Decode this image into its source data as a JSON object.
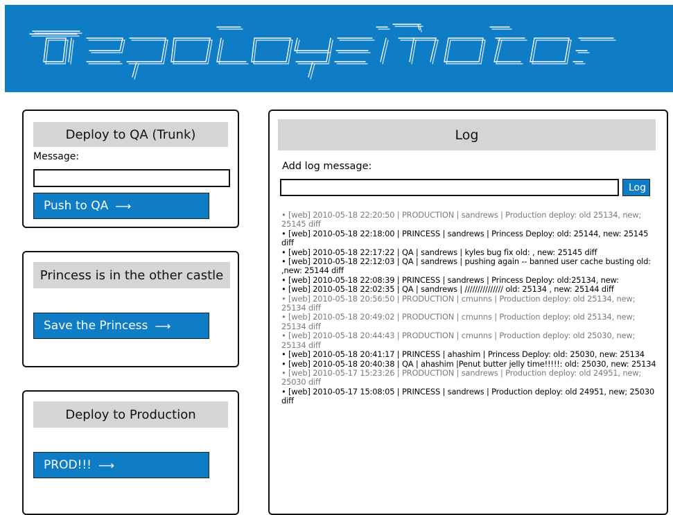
{
  "banner": {
    "logo_text": "deploymotron",
    "bg_color": "#0f7cc6"
  },
  "qa_panel": {
    "title": "Deploy to QA (Trunk)",
    "message_label": "Message:",
    "message_value": "",
    "button_label": "Push to QA",
    "button_icon": "arrow-right-icon"
  },
  "princess_panel": {
    "title": "Princess is in the other castle",
    "button_label": "Save the Princess",
    "button_icon": "arrow-right-icon"
  },
  "prod_panel": {
    "title": "Deploy to Production",
    "button_label": "PROD!!!",
    "button_icon": "arrow-right-icon"
  },
  "log_panel": {
    "title": "Log",
    "add_label": "Add log message:",
    "input_value": "",
    "button_label": "Log",
    "entries": [
      {
        "type": "prod",
        "text": "• [web] 2010-05-18 22:20:50 | PRODUCTION | sandrews | Production deploy: old 25134, new; 25145 diff"
      },
      {
        "type": "other",
        "text": "• [web] 2010-05-18 22:18:00 | PRINCESS | sandrews | Princess Deploy: old: 25144, new: 25145 diff"
      },
      {
        "type": "other",
        "text": "• [web] 2010-05-18 22:17:22 | QA | sandrews | kyles bug fix old: , new: 25145 diff"
      },
      {
        "type": "other",
        "text": "• [web] 2010-05-18 22:12:03 | QA | sandrews | pushing again -- banned user cache busting old: ,new: 25144 diff"
      },
      {
        "type": "other",
        "text": "• [web] 2010-05-18 22:08:39 | PRINCESS | sandrews | Princess Deploy: old:25134, new:"
      },
      {
        "type": "other",
        "text": "• [web] 2010-05-18 22:02:35 | QA | sandrews | /////////////// old: 25134 , new: 25144 diff"
      },
      {
        "type": "prod",
        "text": "• [web] 2010-05-18 20:56:50 | PRODUCTION | cmunns | Production deploy: old 25134, new; 25134 diff"
      },
      {
        "type": "prod",
        "text": "• [web] 2010-05-18 20:49:02 | PRODUCTION | cmunns | Production deploy: old 25134, new; 25134 diff"
      },
      {
        "type": "prod",
        "text": "• [web] 2010-05-18 20:44:43 | PRODUCTION | cmunns | Production deploy: old 25030, new; 25134 diff"
      },
      {
        "type": "other",
        "text": "• [web] 2010-05-18 20:41:17 | PRINCESS | ahashim | Princess Deploy: old: 25030, new: 25134"
      },
      {
        "type": "other",
        "text": "• [web] 2010-05-18 20:40:38 | QA | ahashim |Penut butter jelly time!!!!!: old: 25030, new: 25134"
      },
      {
        "type": "prod",
        "text": "• [web] 2010-05-17 15:23:26 | PRODUCTION | sandrews | Production deploy: old 24951, new; 25030 diff"
      },
      {
        "type": "other",
        "text": "• [web] 2010-05-17 15:08:05 | PRINCESS | sandrews | Production deploy: old 24951, new; 25030 diff"
      }
    ]
  },
  "colors": {
    "accent_blue": "#0f7cc6",
    "header_gray": "#d4d5d6",
    "production_entry": "#7a7a7a"
  }
}
